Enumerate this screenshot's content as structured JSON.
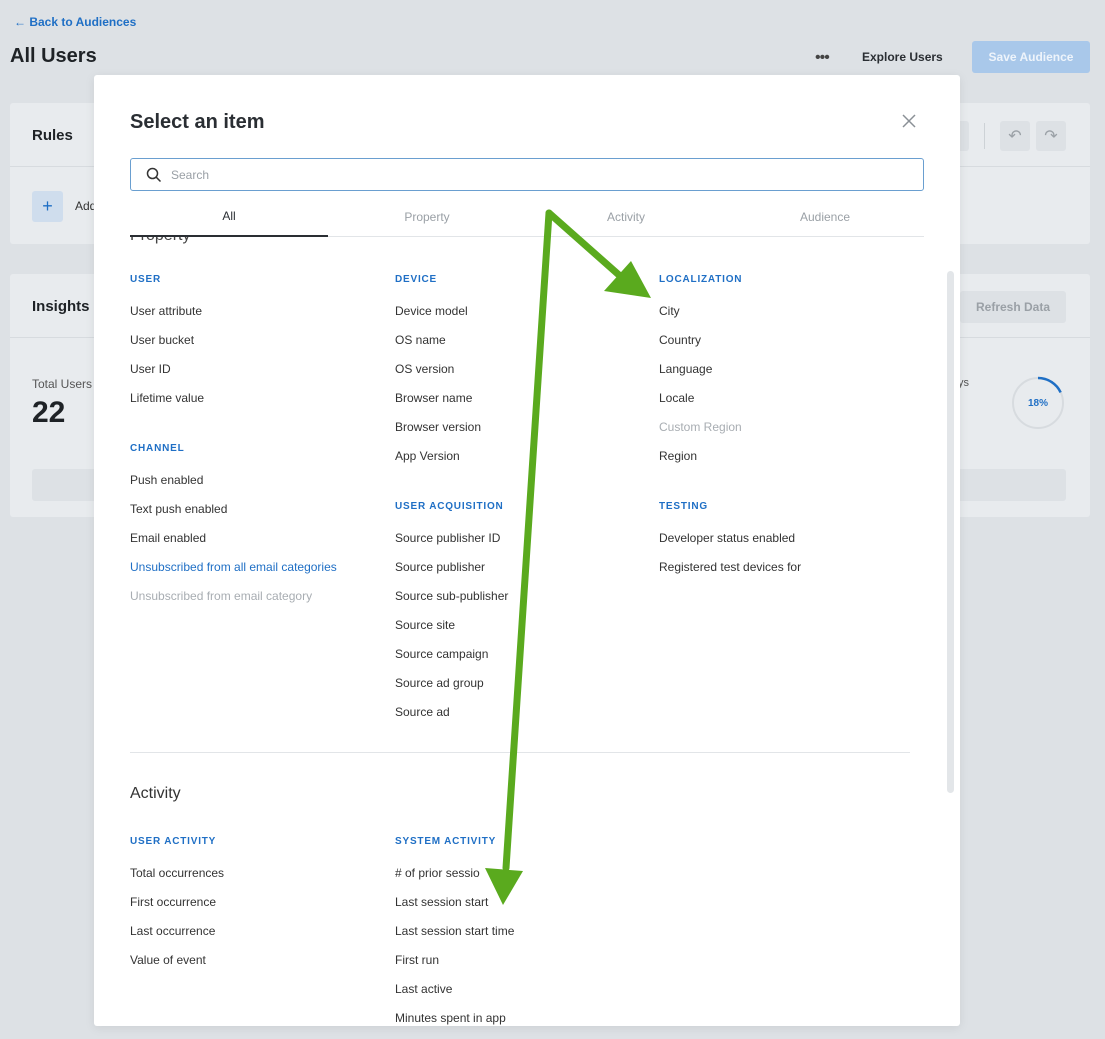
{
  "background": {
    "back_link": "← Back to Audiences",
    "page_title": "All Users",
    "more_icon": "•••",
    "explore_label": "Explore Users",
    "save_label": "Save Audience",
    "rules": {
      "title": "Rules",
      "add_label": "Add"
    },
    "insights": {
      "title": "Insights",
      "refresh_label": "Refresh Data",
      "total_users_label": "Total Users",
      "total_users_value": "22",
      "days_label": "ys",
      "percent_label": "18%",
      "percent_value": 18
    }
  },
  "modal": {
    "title": "Select an item",
    "search_placeholder": "Search",
    "tabs": [
      {
        "label": "All",
        "active": true
      },
      {
        "label": "Property",
        "active": false
      },
      {
        "label": "Activity",
        "active": false
      },
      {
        "label": "Audience",
        "active": false
      }
    ],
    "property_columns": [
      {
        "groups": [
          {
            "category": "USER",
            "items": [
              {
                "label": "User attribute",
                "state": "normal"
              },
              {
                "label": "User bucket",
                "state": "normal"
              },
              {
                "label": "User ID",
                "state": "normal"
              },
              {
                "label": "Lifetime value",
                "state": "normal"
              }
            ]
          },
          {
            "category": "CHANNEL",
            "items": [
              {
                "label": "Push enabled",
                "state": "normal"
              },
              {
                "label": "Text push enabled",
                "state": "normal"
              },
              {
                "label": "Email enabled",
                "state": "normal"
              },
              {
                "label": "Unsubscribed from all email categories",
                "state": "link"
              },
              {
                "label": "Unsubscribed from email category",
                "state": "disabled"
              }
            ]
          }
        ]
      },
      {
        "groups": [
          {
            "category": "DEVICE",
            "items": [
              {
                "label": "Device model",
                "state": "normal"
              },
              {
                "label": "OS name",
                "state": "normal"
              },
              {
                "label": "OS version",
                "state": "normal"
              },
              {
                "label": "Browser name",
                "state": "normal"
              },
              {
                "label": "Browser version",
                "state": "normal"
              },
              {
                "label": "App Version",
                "state": "normal"
              }
            ]
          },
          {
            "category": "USER ACQUISITION",
            "items": [
              {
                "label": "Source publisher ID",
                "state": "normal"
              },
              {
                "label": "Source publisher",
                "state": "normal"
              },
              {
                "label": "Source sub-publisher",
                "state": "normal"
              },
              {
                "label": "Source site",
                "state": "normal"
              },
              {
                "label": "Source campaign",
                "state": "normal"
              },
              {
                "label": "Source ad group",
                "state": "normal"
              },
              {
                "label": "Source ad",
                "state": "normal"
              }
            ]
          }
        ]
      },
      {
        "groups": [
          {
            "category": "LOCALIZATION",
            "items": [
              {
                "label": "City",
                "state": "normal"
              },
              {
                "label": "Country",
                "state": "normal"
              },
              {
                "label": "Language",
                "state": "normal"
              },
              {
                "label": "Locale",
                "state": "normal"
              },
              {
                "label": "Custom Region",
                "state": "disabled"
              },
              {
                "label": "Region",
                "state": "normal"
              }
            ]
          },
          {
            "category": "TESTING",
            "items": [
              {
                "label": "Developer status enabled",
                "state": "normal"
              },
              {
                "label": "Registered test devices for",
                "state": "normal"
              }
            ]
          }
        ]
      }
    ],
    "activity_heading": "Activity",
    "activity_columns": [
      {
        "groups": [
          {
            "category": "USER ACTIVITY",
            "items": [
              {
                "label": "Total occurrences",
                "state": "normal"
              },
              {
                "label": "First occurrence",
                "state": "normal"
              },
              {
                "label": "Last occurrence",
                "state": "normal"
              },
              {
                "label": "Value of event",
                "state": "normal"
              }
            ]
          }
        ]
      },
      {
        "groups": [
          {
            "category": "SYSTEM ACTIVITY",
            "items": [
              {
                "label": "# of prior sessio",
                "state": "normal"
              },
              {
                "label": "Last session start",
                "state": "normal"
              },
              {
                "label": "Last session start time",
                "state": "normal"
              },
              {
                "label": "First run",
                "state": "normal"
              },
              {
                "label": "Last active",
                "state": "normal"
              },
              {
                "label": "Minutes spent in app",
                "state": "normal"
              }
            ]
          }
        ]
      }
    ]
  },
  "colors": {
    "accent": "#1f6fc5",
    "annotation_arrow": "#5aaa1e",
    "disabled": "#a8adb2"
  }
}
